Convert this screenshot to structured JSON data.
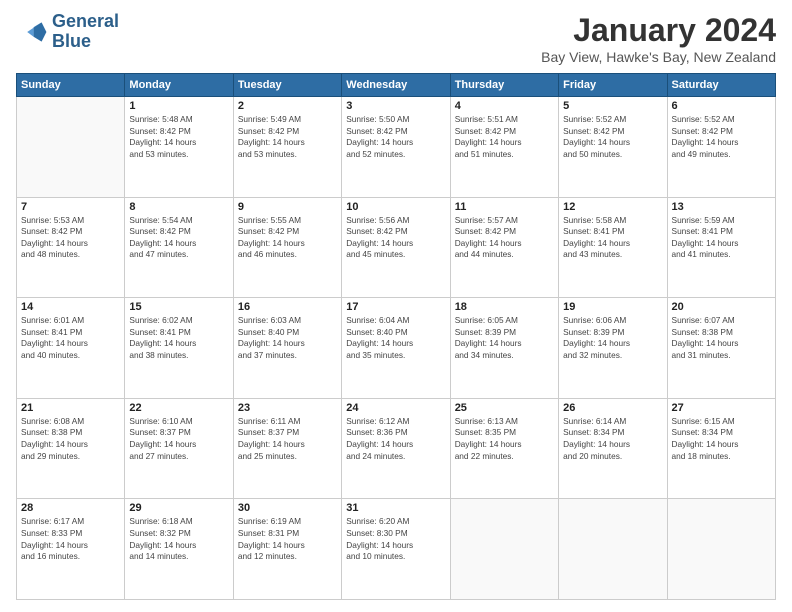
{
  "header": {
    "logo_line1": "General",
    "logo_line2": "Blue",
    "title": "January 2024",
    "subtitle": "Bay View, Hawke's Bay, New Zealand"
  },
  "weekdays": [
    "Sunday",
    "Monday",
    "Tuesday",
    "Wednesday",
    "Thursday",
    "Friday",
    "Saturday"
  ],
  "weeks": [
    [
      {
        "day": "",
        "info": ""
      },
      {
        "day": "1",
        "info": "Sunrise: 5:48 AM\nSunset: 8:42 PM\nDaylight: 14 hours\nand 53 minutes."
      },
      {
        "day": "2",
        "info": "Sunrise: 5:49 AM\nSunset: 8:42 PM\nDaylight: 14 hours\nand 53 minutes."
      },
      {
        "day": "3",
        "info": "Sunrise: 5:50 AM\nSunset: 8:42 PM\nDaylight: 14 hours\nand 52 minutes."
      },
      {
        "day": "4",
        "info": "Sunrise: 5:51 AM\nSunset: 8:42 PM\nDaylight: 14 hours\nand 51 minutes."
      },
      {
        "day": "5",
        "info": "Sunrise: 5:52 AM\nSunset: 8:42 PM\nDaylight: 14 hours\nand 50 minutes."
      },
      {
        "day": "6",
        "info": "Sunrise: 5:52 AM\nSunset: 8:42 PM\nDaylight: 14 hours\nand 49 minutes."
      }
    ],
    [
      {
        "day": "7",
        "info": "Sunrise: 5:53 AM\nSunset: 8:42 PM\nDaylight: 14 hours\nand 48 minutes."
      },
      {
        "day": "8",
        "info": "Sunrise: 5:54 AM\nSunset: 8:42 PM\nDaylight: 14 hours\nand 47 minutes."
      },
      {
        "day": "9",
        "info": "Sunrise: 5:55 AM\nSunset: 8:42 PM\nDaylight: 14 hours\nand 46 minutes."
      },
      {
        "day": "10",
        "info": "Sunrise: 5:56 AM\nSunset: 8:42 PM\nDaylight: 14 hours\nand 45 minutes."
      },
      {
        "day": "11",
        "info": "Sunrise: 5:57 AM\nSunset: 8:42 PM\nDaylight: 14 hours\nand 44 minutes."
      },
      {
        "day": "12",
        "info": "Sunrise: 5:58 AM\nSunset: 8:41 PM\nDaylight: 14 hours\nand 43 minutes."
      },
      {
        "day": "13",
        "info": "Sunrise: 5:59 AM\nSunset: 8:41 PM\nDaylight: 14 hours\nand 41 minutes."
      }
    ],
    [
      {
        "day": "14",
        "info": "Sunrise: 6:01 AM\nSunset: 8:41 PM\nDaylight: 14 hours\nand 40 minutes."
      },
      {
        "day": "15",
        "info": "Sunrise: 6:02 AM\nSunset: 8:41 PM\nDaylight: 14 hours\nand 38 minutes."
      },
      {
        "day": "16",
        "info": "Sunrise: 6:03 AM\nSunset: 8:40 PM\nDaylight: 14 hours\nand 37 minutes."
      },
      {
        "day": "17",
        "info": "Sunrise: 6:04 AM\nSunset: 8:40 PM\nDaylight: 14 hours\nand 35 minutes."
      },
      {
        "day": "18",
        "info": "Sunrise: 6:05 AM\nSunset: 8:39 PM\nDaylight: 14 hours\nand 34 minutes."
      },
      {
        "day": "19",
        "info": "Sunrise: 6:06 AM\nSunset: 8:39 PM\nDaylight: 14 hours\nand 32 minutes."
      },
      {
        "day": "20",
        "info": "Sunrise: 6:07 AM\nSunset: 8:38 PM\nDaylight: 14 hours\nand 31 minutes."
      }
    ],
    [
      {
        "day": "21",
        "info": "Sunrise: 6:08 AM\nSunset: 8:38 PM\nDaylight: 14 hours\nand 29 minutes."
      },
      {
        "day": "22",
        "info": "Sunrise: 6:10 AM\nSunset: 8:37 PM\nDaylight: 14 hours\nand 27 minutes."
      },
      {
        "day": "23",
        "info": "Sunrise: 6:11 AM\nSunset: 8:37 PM\nDaylight: 14 hours\nand 25 minutes."
      },
      {
        "day": "24",
        "info": "Sunrise: 6:12 AM\nSunset: 8:36 PM\nDaylight: 14 hours\nand 24 minutes."
      },
      {
        "day": "25",
        "info": "Sunrise: 6:13 AM\nSunset: 8:35 PM\nDaylight: 14 hours\nand 22 minutes."
      },
      {
        "day": "26",
        "info": "Sunrise: 6:14 AM\nSunset: 8:34 PM\nDaylight: 14 hours\nand 20 minutes."
      },
      {
        "day": "27",
        "info": "Sunrise: 6:15 AM\nSunset: 8:34 PM\nDaylight: 14 hours\nand 18 minutes."
      }
    ],
    [
      {
        "day": "28",
        "info": "Sunrise: 6:17 AM\nSunset: 8:33 PM\nDaylight: 14 hours\nand 16 minutes."
      },
      {
        "day": "29",
        "info": "Sunrise: 6:18 AM\nSunset: 8:32 PM\nDaylight: 14 hours\nand 14 minutes."
      },
      {
        "day": "30",
        "info": "Sunrise: 6:19 AM\nSunset: 8:31 PM\nDaylight: 14 hours\nand 12 minutes."
      },
      {
        "day": "31",
        "info": "Sunrise: 6:20 AM\nSunset: 8:30 PM\nDaylight: 14 hours\nand 10 minutes."
      },
      {
        "day": "",
        "info": ""
      },
      {
        "day": "",
        "info": ""
      },
      {
        "day": "",
        "info": ""
      }
    ]
  ]
}
